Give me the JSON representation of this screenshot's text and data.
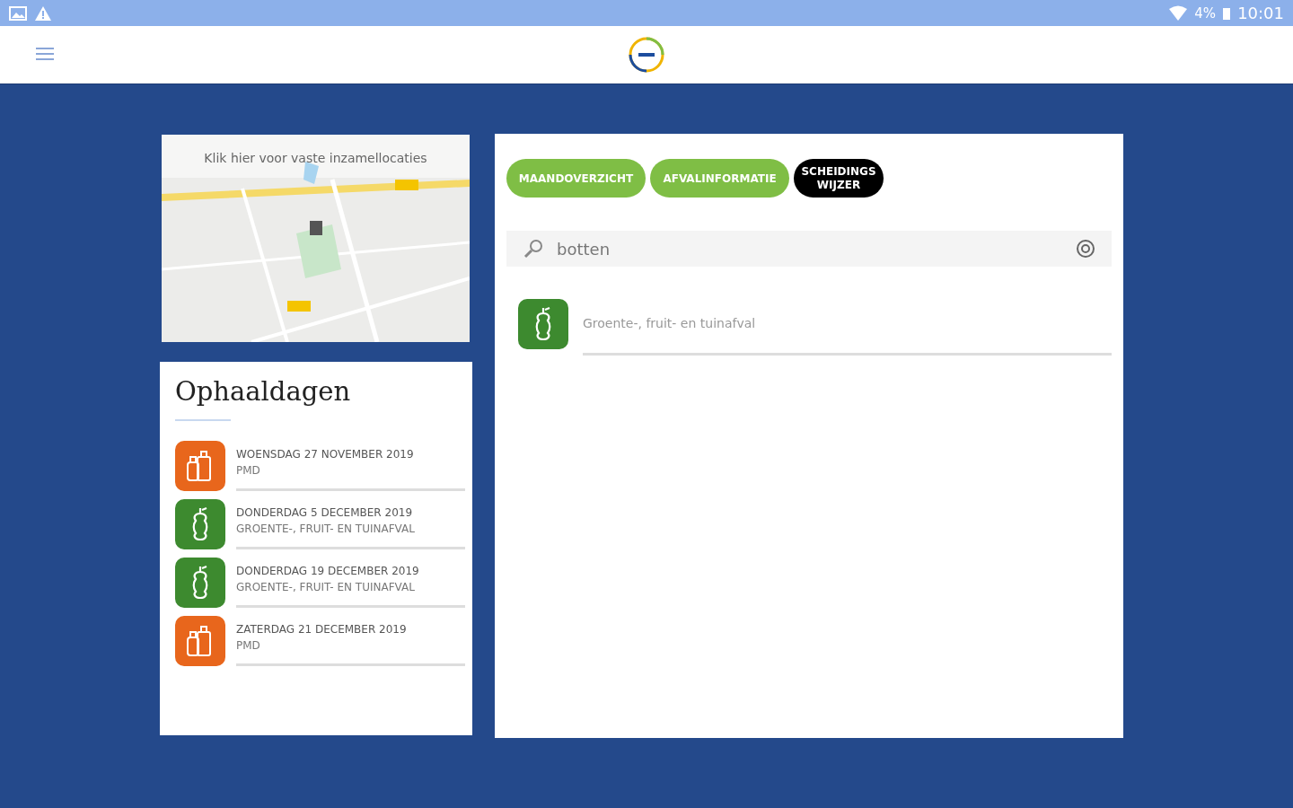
{
  "status_bar": {
    "battery": "4%",
    "time": "10:01"
  },
  "map_card": {
    "kind": "picture",
    "caption": "Klik hier voor vaste inzamellocaties"
  },
  "pickups": {
    "title": "Ophaaldagen",
    "items": [
      {
        "kind": "pmd",
        "date": "WOENSDAG 27 NOVEMBER 2019",
        "type": "PMD"
      },
      {
        "kind": "gft",
        "date": "DONDERDAG 5 DECEMBER 2019",
        "type": "GROENTE-, FRUIT- EN TUINAFVAL"
      },
      {
        "kind": "gft",
        "date": "DONDERDAG 19 DECEMBER 2019",
        "type": "GROENTE-, FRUIT- EN TUINAFVAL"
      },
      {
        "kind": "pmd",
        "date": "ZATERDAG 21 DECEMBER 2019",
        "type": "PMD"
      }
    ]
  },
  "tabs": [
    {
      "label": "MAANDOVERZICHT",
      "selected": false
    },
    {
      "label": "AFVALINFORMATIE",
      "selected": false
    },
    {
      "label": "SCHEIDINGS WIJZER",
      "selected": true
    }
  ],
  "search": {
    "value": "botten"
  },
  "results": [
    {
      "kind": "gft",
      "label": "Groente-, fruit- en tuinafval"
    }
  ]
}
